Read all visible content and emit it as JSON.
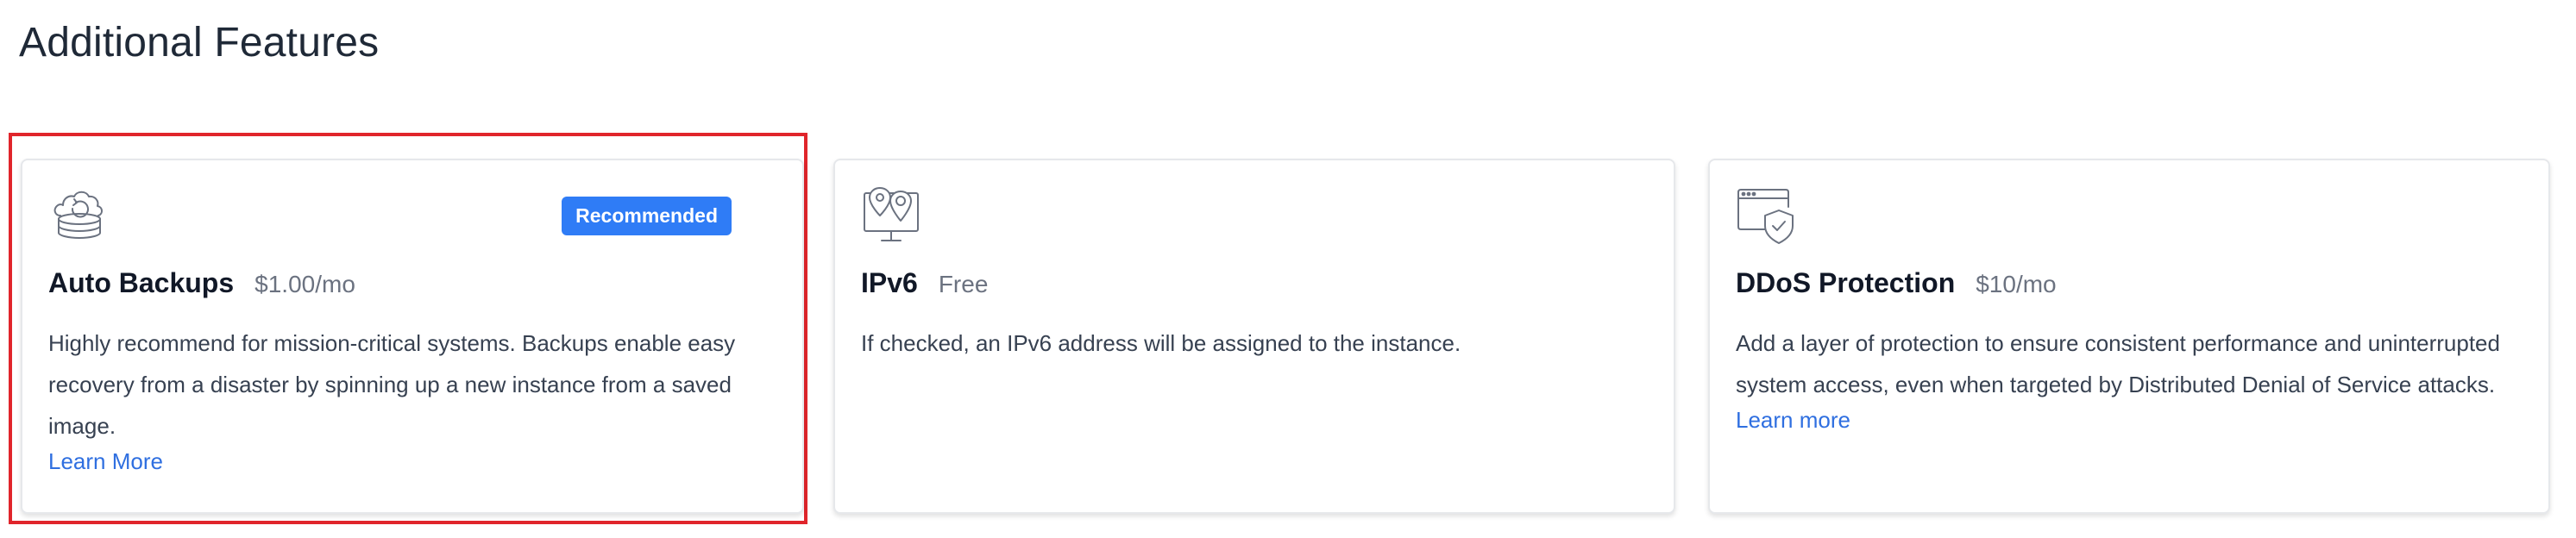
{
  "section": {
    "title": "Additional Features"
  },
  "cards": [
    {
      "icon": "cloud-backup-icon",
      "badge": "Recommended",
      "title": "Auto Backups",
      "price": "$1.00/mo",
      "description": "Highly recommend for mission-critical systems. Backups enable easy recovery from a disaster by spinning up a new instance from a saved image.",
      "link": "Learn More",
      "selected": true
    },
    {
      "icon": "map-pin-icon",
      "title": "IPv6",
      "price": "Free",
      "description": "If checked, an IPv6 address will be assigned to the instance."
    },
    {
      "icon": "shield-window-icon",
      "title": "DDoS Protection",
      "price": "$10/mo",
      "description": "Add a layer of protection to ensure consistent performance and uninterrupted system access, even when targeted by Distributed Denial of Service attacks.",
      "link": "Learn more"
    }
  ],
  "colors": {
    "accent": "#2f7cf6",
    "link": "#2f6fe0",
    "selection": "#e0252b"
  }
}
